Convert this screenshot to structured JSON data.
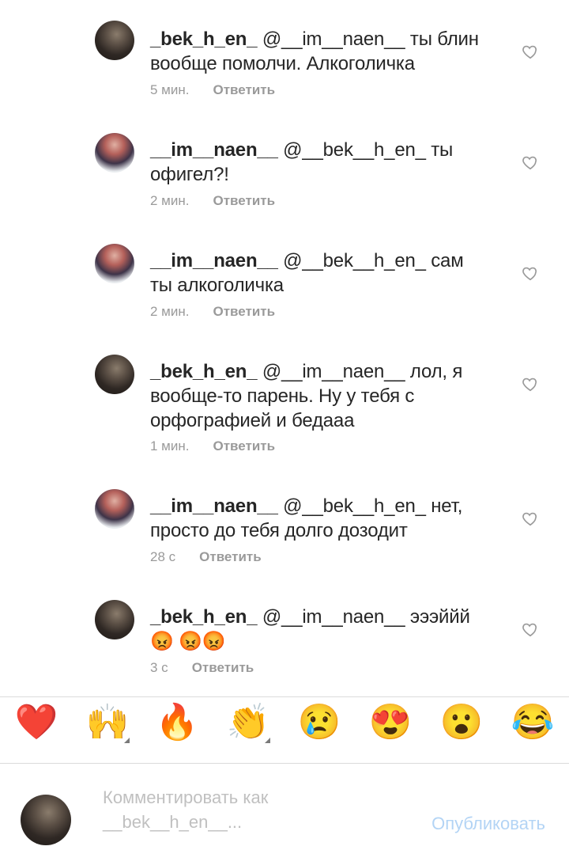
{
  "comments": [
    {
      "avatar": "dark",
      "user": "_bek_h_en_",
      "text": " @__im__naen__ ты блин вообще помолчи. Алкоголичка",
      "time": "5 мин.",
      "reply": "Ответить"
    },
    {
      "avatar": "girl",
      "user": "__im__naen__",
      "text": " @__bek__h_en_ ты офигел?!",
      "time": "2 мин.",
      "reply": "Ответить"
    },
    {
      "avatar": "girl",
      "user": "__im__naen__",
      "text": " @__bek__h_en_ сам ты алкоголичка",
      "time": "2 мин.",
      "reply": "Ответить"
    },
    {
      "avatar": "dark",
      "user": "_bek_h_en_",
      "text": " @__im__naen__ лол, я вообще-то парень. Ну у тебя с орфографией и бедааа",
      "time": "1 мин.",
      "reply": "Ответить"
    },
    {
      "avatar": "girl",
      "user": "__im__naen__",
      "text": " @__bek__h_en_ нет, просто до тебя долго дозодит",
      "time": "28 с",
      "reply": "Ответить"
    },
    {
      "avatar": "dark",
      "user": "_bek_h_en_",
      "text": " @__im__naen__ эээййй😡 😡😡",
      "time": "3 с",
      "reply": "Ответить"
    }
  ],
  "reactions": [
    {
      "name": "heart-emoji",
      "glyph": "❤️",
      "variants": false
    },
    {
      "name": "raising-hands-emoji",
      "glyph": "🙌",
      "variants": true
    },
    {
      "name": "fire-emoji",
      "glyph": "🔥",
      "variants": false
    },
    {
      "name": "clapping-hands-emoji",
      "glyph": "👏",
      "variants": true
    },
    {
      "name": "crying-face-emoji",
      "glyph": "😢",
      "variants": false
    },
    {
      "name": "heart-eyes-emoji",
      "glyph": "😍",
      "variants": false
    },
    {
      "name": "surprised-face-emoji",
      "glyph": "😮",
      "variants": false
    },
    {
      "name": "tears-of-joy-emoji",
      "glyph": "😂",
      "variants": false
    }
  ],
  "composer": {
    "placeholder": "Комментировать как __bek__h_en__...",
    "post_label": "Опубликовать"
  },
  "colors": {
    "link_disabled": "#b3d4f5",
    "meta_gray": "#9a9a9a"
  },
  "icons": {
    "like": "heart-outline-icon"
  }
}
